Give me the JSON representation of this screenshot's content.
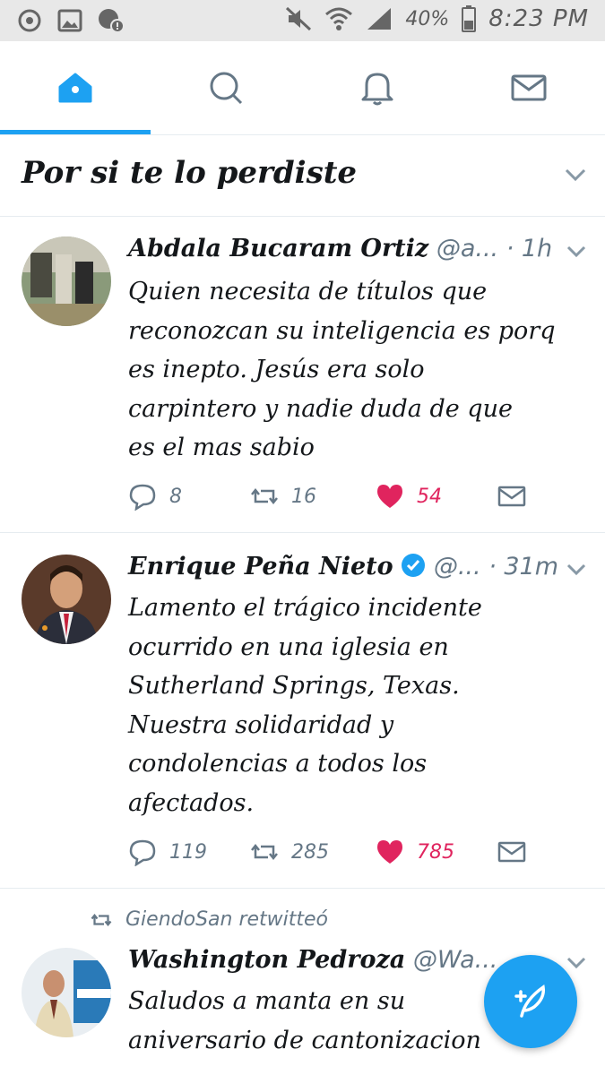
{
  "status_bar": {
    "battery": "40%",
    "time": "8:23 PM",
    "icons": [
      "sync-icon",
      "image-icon",
      "alert-icon",
      "mute-icon",
      "wifi-icon",
      "signal-icon",
      "battery-icon"
    ]
  },
  "nav": {
    "tabs": [
      {
        "name": "home-icon",
        "active": true
      },
      {
        "name": "search-icon",
        "active": false
      },
      {
        "name": "bell-icon",
        "active": false
      },
      {
        "name": "mail-icon",
        "active": false
      }
    ],
    "accent": "#1da1f2"
  },
  "section": {
    "title": "Por si te lo perdiste"
  },
  "tweets": [
    {
      "name": "Abdala Bucaram Ortiz",
      "handle": "@a...",
      "time": "· 1h",
      "text": [
        "Quien necesita de títulos que",
        "reconozcan su inteligencia es porq",
        "es inepto. Jesús era solo",
        "carpintero y nadie duda de que",
        "es el mas sabio"
      ],
      "replies": "8",
      "retweets": "16",
      "likes": "54"
    },
    {
      "name": "Enrique Peña Nieto",
      "handle": "@...",
      "time": "· 31m",
      "verified": true,
      "text": [
        "Lamento el trágico incidente",
        "ocurrido en una iglesia en",
        "Sutherland Springs, Texas.",
        "Nuestra solidaridad y",
        "condolencias a todos los",
        "afectados."
      ],
      "replies": "119",
      "retweets": "285",
      "likes": "785"
    },
    {
      "retweeted_by": "GiendoSan retwitteó",
      "name": "Washington Pedroza",
      "handle": "@Wa...",
      "text": [
        "Saludos a manta en su",
        "aniversario de cantonizacion"
      ]
    }
  ],
  "compose": {
    "icon": "compose-feather-icon"
  },
  "colors": {
    "like": "#e0245e",
    "muted": "#657786",
    "accent": "#1da1f2"
  }
}
